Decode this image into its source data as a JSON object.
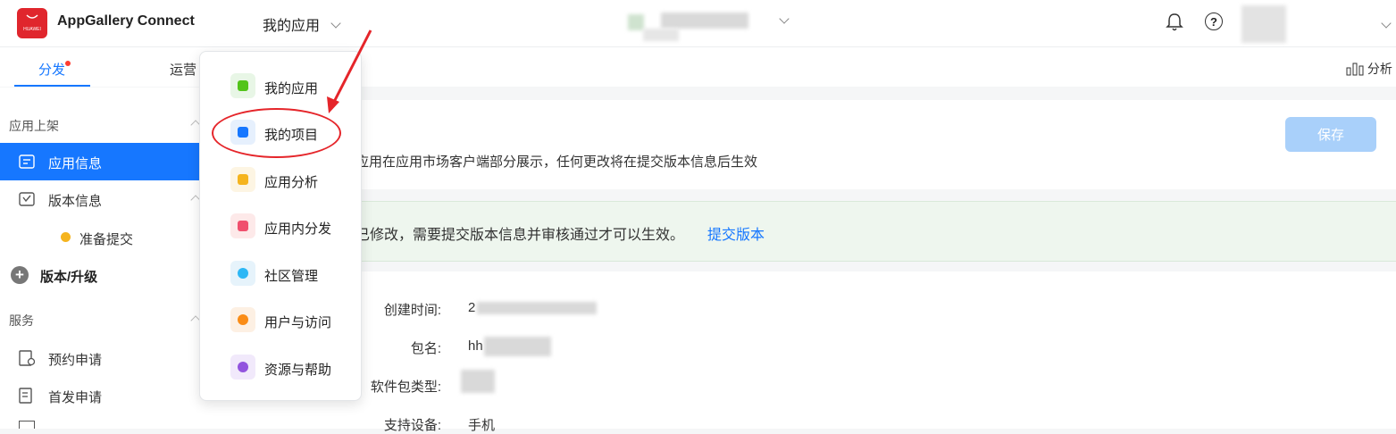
{
  "topbar": {
    "app_title": "AppGallery Connect",
    "logo_text": "HUAWEI",
    "my_apps_label": "我的应用"
  },
  "subnav": {
    "tab_distribution": "分发",
    "tab_operations": "运营",
    "analysis_label": "分析"
  },
  "sidebar": {
    "section_listing": "应用上架",
    "items": [
      {
        "label": "应用信息",
        "icon": "app-info-icon"
      },
      {
        "label": "版本信息",
        "icon": "version-info-icon"
      }
    ],
    "sub_status": "准备提交",
    "version_upgrade": "版本/升级",
    "section_services": "服务",
    "services": [
      {
        "label": "预约申请",
        "icon": "reservation-icon"
      },
      {
        "label": "首发申请",
        "icon": "first-launch-icon"
      }
    ]
  },
  "dropdown": {
    "items": [
      {
        "label": "我的应用",
        "color": "#e8f6e6",
        "dot": "#52c41a"
      },
      {
        "label": "我的项目",
        "color": "#e6f0fd",
        "dot": "#1677ff"
      },
      {
        "label": "应用分析",
        "color": "#fdf5e3",
        "dot": "#f5b41e"
      },
      {
        "label": "应用内分发",
        "color": "#fde9e9",
        "dot": "#f0506e"
      },
      {
        "label": "社区管理",
        "color": "#e6f3fb",
        "dot": "#2db7f5"
      },
      {
        "label": "用户与访问",
        "color": "#fdf0e3",
        "dot": "#fa8c16"
      },
      {
        "label": "资源与帮助",
        "color": "#f1e9fb",
        "dot": "#9254de"
      }
    ]
  },
  "main": {
    "save_button": "保存",
    "description": "应用在应用市场客户端部分展示，任何更改将在提交版本信息后生效",
    "banner_text": "已修改，需要提交版本信息并审核通过才可以生效。",
    "banner_link": "提交版本",
    "fields": [
      {
        "label": "创建时间:",
        "value": "2"
      },
      {
        "label": "包名:",
        "value": "hh"
      },
      {
        "label": "软件包类型:",
        "value": ""
      },
      {
        "label": "支持设备:",
        "value": "手机"
      }
    ]
  },
  "colors": {
    "accent": "#1677ff",
    "annotation": "#e5252a"
  }
}
